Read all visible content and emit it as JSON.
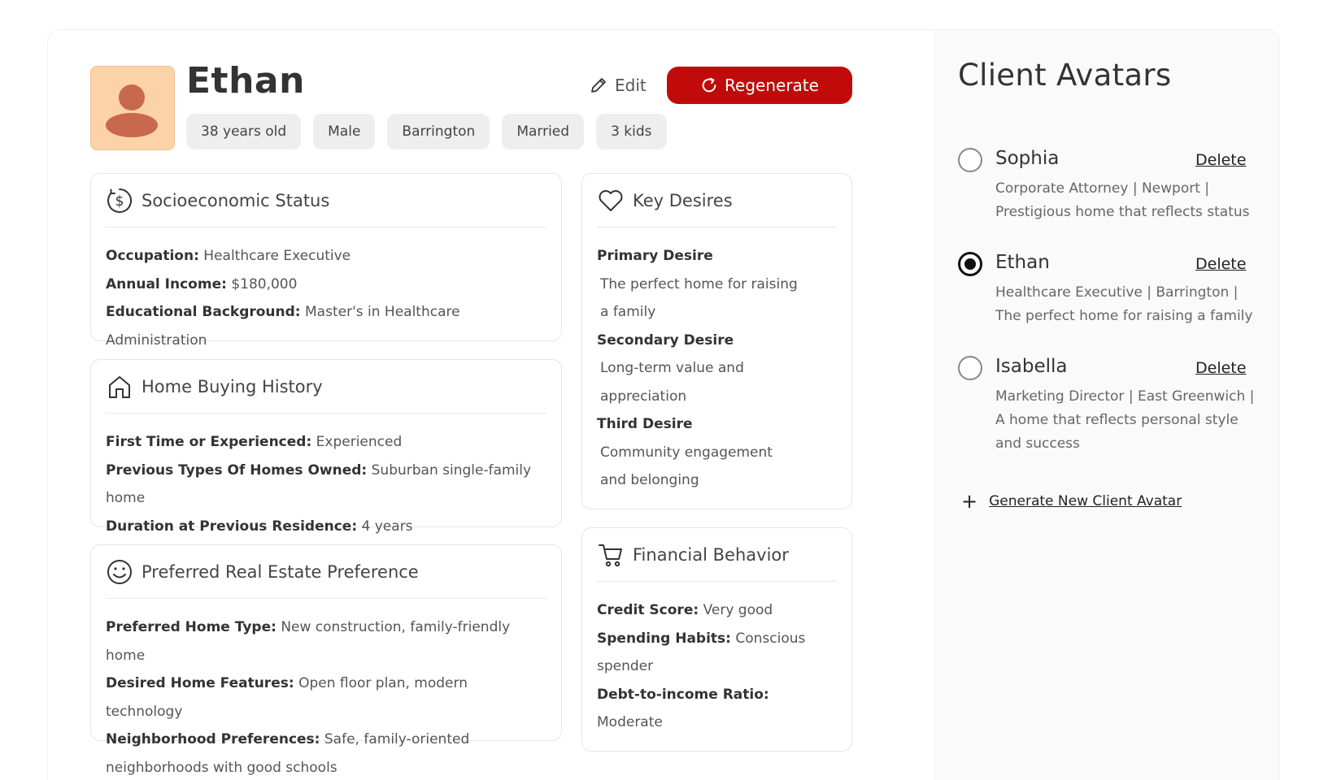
{
  "profile": {
    "name": "Ethan",
    "edit_label": "Edit",
    "regenerate_label": "Regenerate",
    "tags": [
      "38 years old",
      "Male",
      "Barrington",
      "Married",
      "3 kids"
    ],
    "avatar_color": "#fcd3a8",
    "avatar_figure_color": "#c8684c"
  },
  "accent_color": "#c10b0b",
  "socioeconomic": {
    "title": "Socioeconomic Status",
    "icon": "dollar-circle-icon",
    "rows": [
      {
        "label": "Occupation:",
        "value": "Healthcare Executive"
      },
      {
        "label": "Annual Income:",
        "value": "$180,000"
      },
      {
        "label": "Educational Background:",
        "value": "Master's in Healthcare Administration"
      }
    ]
  },
  "home_buying": {
    "title": "Home Buying History",
    "icon": "home-icon",
    "rows": [
      {
        "label": "First Time or Experienced:",
        "value": "Experienced"
      },
      {
        "label": "Previous Types Of Homes Owned:",
        "value": "Suburban single-family home"
      },
      {
        "label": "Duration at Previous Residence:",
        "value": "4 years"
      }
    ]
  },
  "preference": {
    "title": "Preferred Real Estate Preference",
    "icon": "smile-icon",
    "rows": [
      {
        "label": "Preferred Home Type:",
        "value": "New construction, family-friendly home"
      },
      {
        "label": "Desired Home Features:",
        "value": "Open floor plan, modern technology"
      },
      {
        "label": "Neighborhood Preferences:",
        "value": "Safe, family-oriented"
      }
    ],
    "continuation": "neighborhoods with good schools"
  },
  "key_desires": {
    "title": "Key Desires",
    "icon": "heart-icon",
    "items": [
      {
        "label": "Primary Desire",
        "line1": "The perfect home for raising",
        "line2": "a family"
      },
      {
        "label": "Secondary Desire",
        "line1": "Long-term value and",
        "line2": "appreciation"
      },
      {
        "label": "Third Desire",
        "line1": "Community engagement",
        "line2": "and belonging"
      }
    ]
  },
  "financial": {
    "title": "Financial Behavior",
    "icon": "cart-icon",
    "credit_label": "Credit Score:",
    "credit_value": "Very good",
    "spending_label": "Spending Habits:",
    "spending_value": "Conscious",
    "spending_value_cont": "spender",
    "debt_label": "Debt-to-income Ratio:",
    "debt_value": "Moderate"
  },
  "client_avatars": {
    "title": "Client Avatars",
    "delete_label": "Delete",
    "generate_label": "Generate New Client Avatar",
    "clients": [
      {
        "name": "Sophia",
        "selected": false,
        "line1": "Corporate Attorney | Newport |",
        "line2": "Prestigious home that reflects status",
        "line3": ""
      },
      {
        "name": "Ethan",
        "selected": true,
        "line1": "Healthcare Executive | Barrington |",
        "line2": "The perfect home for raising a family",
        "line3": ""
      },
      {
        "name": "Isabella",
        "selected": false,
        "line1": "Marketing Director | East Greenwich |",
        "line2": "A home that reflects personal style",
        "line3": "and success"
      }
    ]
  }
}
